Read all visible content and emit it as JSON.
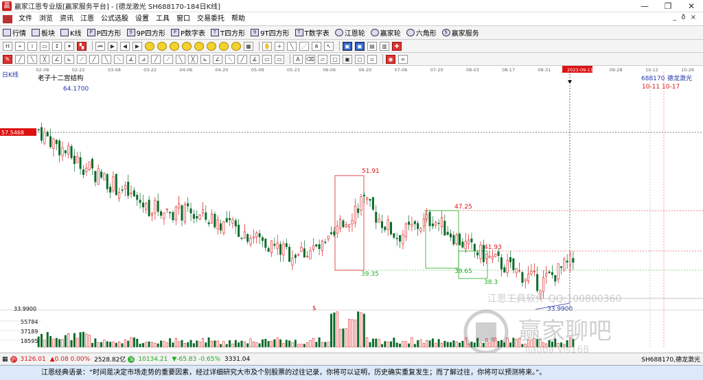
{
  "window": {
    "title": "赢家江恩专业版[赢家服务平台] - [德龙激光  SH688170-184日K线]",
    "controls": [
      "—",
      "❐",
      "✕"
    ]
  },
  "menu": {
    "items": [
      "文件",
      "浏览",
      "资讯",
      "江恩",
      "公式选股",
      "设置",
      "工具",
      "窗口",
      "交易委托",
      "帮助"
    ],
    "mdi_controls": "_ ð ×"
  },
  "quickbar": {
    "items": [
      {
        "label": "行情",
        "icon": "grid-icon"
      },
      {
        "label": "板块",
        "icon": "grid-icon"
      },
      {
        "label": "K线",
        "icon": "candle-icon"
      },
      {
        "label": "P四方形",
        "icon": "square-icon"
      },
      {
        "label": "9P四方形",
        "icon": "square-icon"
      },
      {
        "label": "P数字表",
        "icon": "table-icon"
      },
      {
        "label": "T四方形",
        "icon": "square-icon"
      },
      {
        "label": "9T四方形",
        "icon": "square-icon"
      },
      {
        "label": "T数字表",
        "icon": "table-icon"
      },
      {
        "label": "江恩轮",
        "icon": "wheel-icon"
      },
      {
        "label": "赢家轮",
        "icon": "wheel-icon"
      },
      {
        "label": "六角形",
        "icon": "hexagon-icon"
      },
      {
        "label": "赢家服务",
        "icon": "dollar-icon"
      }
    ]
  },
  "chart": {
    "period_label": "日K线",
    "title": "老子十二宫结构",
    "stock_code": "688170",
    "stock_name": "德龙激光",
    "date_axis": [
      "02-08",
      "02-22",
      "03-08",
      "03-22",
      "04-06",
      "04-20",
      "05-09",
      "05-23",
      "06-06",
      "06-20",
      "07-06",
      "07-20",
      "08-03",
      "08-17",
      "08-31",
      "2023-09-11",
      "09-28",
      "10-12",
      "10-26"
    ],
    "crosshair_price": "57.5468",
    "date_markers": "10-11 10-17",
    "price_annotations": [
      "64.1700",
      "51.91",
      "39.35",
      "47.25",
      "41.93",
      "39.65",
      "38.3",
      "33.9900"
    ],
    "volume_axis": [
      "33.9900",
      "55784",
      "37189",
      "18595"
    ],
    "volume_marker": "$",
    "watermark_text": "江恩工具软件 QQ:100800360",
    "watermark_brand": "赢家聊吧",
    "watermark_url": "liaoba.yjs168"
  },
  "chart_data": {
    "type": "candlestick",
    "x": [
      "02-08",
      "02-22",
      "03-08",
      "03-22",
      "04-06",
      "04-20",
      "05-09",
      "05-23",
      "06-06",
      "06-20",
      "07-06",
      "07-20",
      "08-03",
      "08-17",
      "08-31",
      "09-11"
    ],
    "close": [
      61,
      56,
      52,
      48,
      47,
      45.5,
      43,
      40,
      41,
      49,
      43,
      46,
      41,
      38,
      35,
      39
    ],
    "annotations": [
      "64.1700",
      "51.91",
      "47.25",
      "41.93",
      "39.35",
      "33.9900"
    ]
  },
  "status": {
    "index1_val": "3126.01",
    "index1_chg": "▲0.08 0.00%",
    "index1_amt": "2528.82亿",
    "index2_val": "10134.21",
    "index2_chg": "▼-65.83 -0.65%",
    "index2_amt": "3331.04",
    "right_text": "SH688170,德龙激光"
  },
  "quote": "江恩经典语录：“时间是决定市场走势的重要因素，经过详细研究大市及个别股票的过往记录，你将可以证明，历史确实重复发生；而了解过往，你将可以预测将来。”。"
}
